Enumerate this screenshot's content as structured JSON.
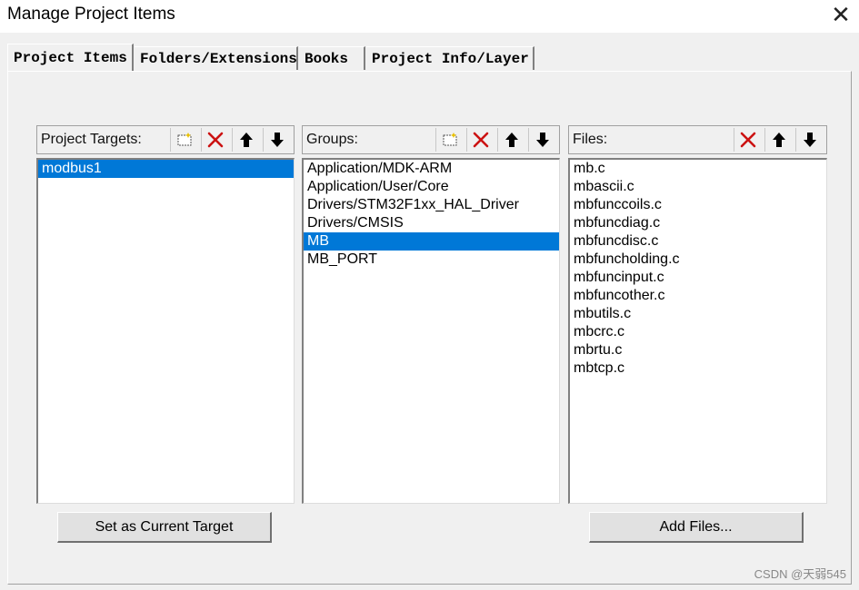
{
  "window": {
    "title": "Manage Project Items",
    "close_glyph": "✕"
  },
  "tabs": [
    {
      "label": "Project Items",
      "active": true
    },
    {
      "label": "Folders/Extensions",
      "active": false
    },
    {
      "label": "Books",
      "active": false
    },
    {
      "label": "Project Info/Layer",
      "active": false
    }
  ],
  "targets": {
    "label": "Project Targets:",
    "items": [
      "modbus1"
    ],
    "selected_index": 0,
    "button_label": "Set as Current Target"
  },
  "groups": {
    "label": "Groups:",
    "items": [
      "Application/MDK-ARM",
      "Application/User/Core",
      "Drivers/STM32F1xx_HAL_Driver",
      "Drivers/CMSIS",
      "MB",
      "MB_PORT"
    ],
    "selected_index": 4
  },
  "files": {
    "label": "Files:",
    "items": [
      "mb.c",
      "mbascii.c",
      "mbfunccoils.c",
      "mbfuncdiag.c",
      "mbfuncdisc.c",
      "mbfuncholding.c",
      "mbfuncinput.c",
      "mbfuncother.c",
      "mbutils.c",
      "mbcrc.c",
      "mbrtu.c",
      "mbtcp.c"
    ],
    "button_label": "Add Files..."
  },
  "toolbar_icons": {
    "new": "new-icon",
    "delete": "delete-icon",
    "move_up": "move-up-icon",
    "move_down": "move-down-icon"
  },
  "colors": {
    "selection": "#0078d7",
    "delete_red": "#cc1111"
  },
  "watermark": "CSDN @天弱545"
}
